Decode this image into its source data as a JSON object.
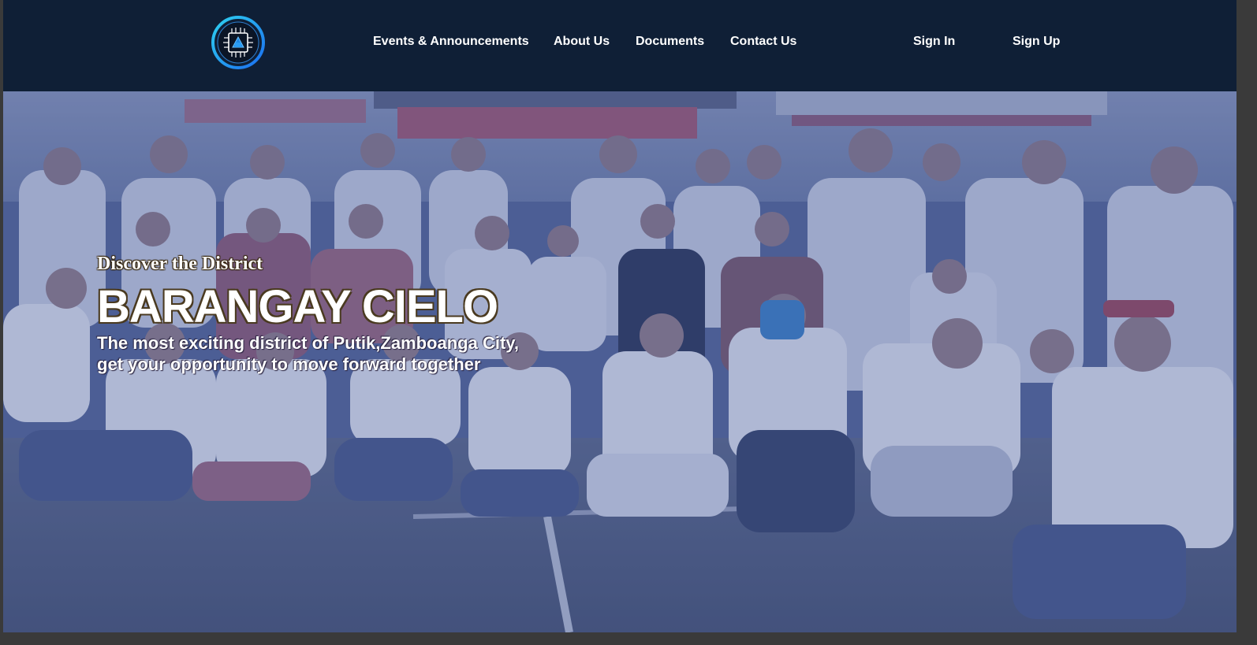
{
  "header": {
    "logo_icon": "circuit-chip-logo",
    "nav": [
      {
        "label": "Events & Announcements"
      },
      {
        "label": "About Us"
      },
      {
        "label": "Documents"
      },
      {
        "label": "Contact Us"
      }
    ],
    "auth": {
      "sign_in": "Sign In",
      "sign_up": "Sign Up"
    }
  },
  "hero": {
    "eyebrow": "Discover the District",
    "title": "BARANGAY CIELO",
    "tagline_line1": "The most exciting district of Putik,Zamboanga City,",
    "tagline_line2": "get your opportunity to move forward together",
    "background_image": "crowd-photo"
  },
  "colors": {
    "navbar": "#0f1f36",
    "text": "#ffffff",
    "hero_tint": "#56679a"
  }
}
